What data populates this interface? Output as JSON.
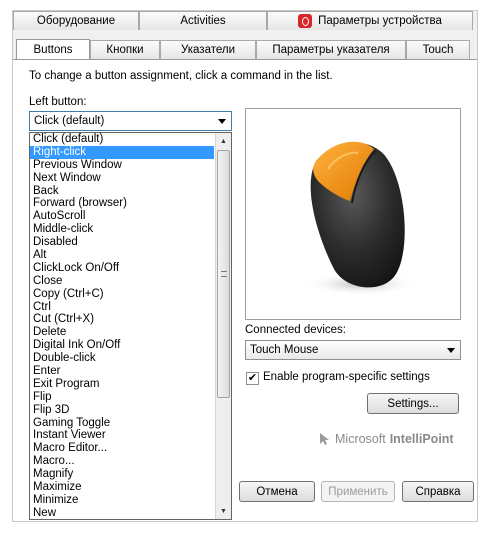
{
  "tabs_top": [
    {
      "label": "Оборудование"
    },
    {
      "label": "Activities"
    },
    {
      "label": "Параметры устройства",
      "icon": "device-settings-icon"
    }
  ],
  "tabs_bottom": [
    {
      "label": "Buttons",
      "active": true
    },
    {
      "label": "Кнопки"
    },
    {
      "label": "Указатели"
    },
    {
      "label": "Параметры указателя"
    },
    {
      "label": "Touch"
    }
  ],
  "instructions": "To change a button assignment, click a command in the list.",
  "left_button": {
    "label": "Left button:",
    "selected": "Click (default)",
    "options": [
      "Click (default)",
      "Right-click",
      "Previous Window",
      "Next Window",
      "Back",
      "Forward (browser)",
      "AutoScroll",
      "Middle-click",
      "Disabled",
      "Alt",
      "ClickLock On/Off",
      "Close",
      "Copy (Ctrl+C)",
      "Ctrl",
      "Cut (Ctrl+X)",
      "Delete",
      "Digital Ink On/Off",
      "Double-click",
      "Enter",
      "Exit Program",
      "Flip",
      "Flip 3D",
      "Gaming Toggle",
      "Instant Viewer",
      "Macro Editor...",
      "Macro...",
      "Magnify",
      "Maximize",
      "Minimize",
      "New"
    ],
    "highlighted": "Right-click"
  },
  "connected_devices": {
    "label": "Connected devices:",
    "value": "Touch Mouse"
  },
  "program_specific": {
    "label": "Enable program-specific settings",
    "checked": true
  },
  "settings_button": "Settings...",
  "brand": {
    "prefix": "Microsoft",
    "product": "IntelliPoint"
  },
  "footer_buttons": {
    "cancel": "Отмена",
    "apply": "Применить",
    "help": "Справка"
  },
  "colors": {
    "selection": "#3399ff",
    "mouse_accent": "#f7941d",
    "mouse_body": "#2a2a2a"
  }
}
